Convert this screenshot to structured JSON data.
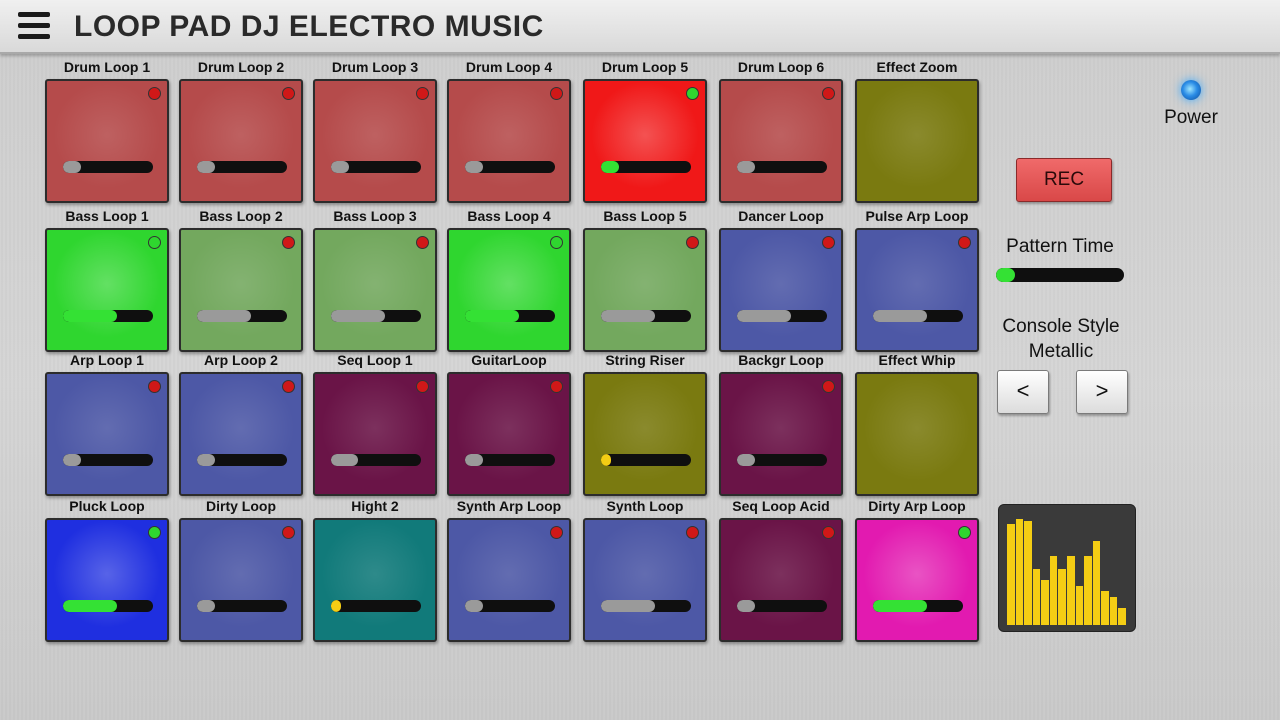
{
  "app": {
    "title": "LOOP PAD DJ ELECTRO MUSIC"
  },
  "pads": [
    {
      "label": "Drum Loop 1",
      "color": "#b54b4b",
      "active": false,
      "led": "red",
      "level": 0.2
    },
    {
      "label": "Drum Loop 2",
      "color": "#b54b4b",
      "active": false,
      "led": "red",
      "level": 0.2
    },
    {
      "label": "Drum Loop 3",
      "color": "#b54b4b",
      "active": false,
      "led": "red",
      "level": 0.2
    },
    {
      "label": "Drum Loop 4",
      "color": "#b54b4b",
      "active": false,
      "led": "red",
      "level": 0.2
    },
    {
      "label": "Drum Loop 5",
      "color": "#f01818",
      "active": true,
      "led": "green",
      "level": 0.2
    },
    {
      "label": "Drum Loop 6",
      "color": "#b54b4b",
      "active": false,
      "led": "red",
      "level": 0.2
    },
    {
      "label": "Effect Zoom",
      "color": "#7a7a10",
      "active": false,
      "led": "none",
      "level": null
    },
    {
      "label": "Bass Loop 1",
      "color": "#2fd62f",
      "active": true,
      "led": "green",
      "level": 0.6
    },
    {
      "label": "Bass Loop 2",
      "color": "#73a85e",
      "active": false,
      "led": "red",
      "level": 0.6
    },
    {
      "label": "Bass Loop 3",
      "color": "#73a85e",
      "active": false,
      "led": "red",
      "level": 0.6
    },
    {
      "label": "Bass Loop 4",
      "color": "#2fd62f",
      "active": true,
      "led": "green",
      "level": 0.6
    },
    {
      "label": "Bass Loop 5",
      "color": "#73a85e",
      "active": false,
      "led": "red",
      "level": 0.6
    },
    {
      "label": "Dancer Loop",
      "color": "#4d58a6",
      "active": false,
      "led": "red",
      "level": 0.6
    },
    {
      "label": "Pulse Arp Loop",
      "color": "#4d58a6",
      "active": false,
      "led": "red",
      "level": 0.6
    },
    {
      "label": "Arp Loop 1",
      "color": "#4d58a6",
      "active": false,
      "led": "red",
      "level": 0.2
    },
    {
      "label": "Arp Loop 2",
      "color": "#4d58a6",
      "active": false,
      "led": "red",
      "level": 0.2
    },
    {
      "label": "Seq Loop 1",
      "color": "#6a1447",
      "active": false,
      "led": "red",
      "level": 0.3
    },
    {
      "label": "GuitarLoop",
      "color": "#6a1447",
      "active": false,
      "led": "red",
      "level": 0.2
    },
    {
      "label": "String Riser",
      "color": "#7a7a10",
      "active": false,
      "led": "none",
      "level": 0.05
    },
    {
      "label": "Backgr Loop",
      "color": "#6a1447",
      "active": false,
      "led": "red",
      "level": 0.2
    },
    {
      "label": "Effect Whip",
      "color": "#7a7a10",
      "active": false,
      "led": "none",
      "level": null
    },
    {
      "label": "Pluck Loop",
      "color": "#1f2fe0",
      "active": true,
      "led": "green",
      "level": 0.6
    },
    {
      "label": "Dirty Loop",
      "color": "#4d58a6",
      "active": false,
      "led": "red",
      "level": 0.2
    },
    {
      "label": "Hight 2",
      "color": "#117a7a",
      "active": false,
      "led": "none",
      "level": 0.05
    },
    {
      "label": "Synth Arp Loop",
      "color": "#4d58a6",
      "active": false,
      "led": "red",
      "level": 0.2
    },
    {
      "label": "Synth Loop",
      "color": "#4d58a6",
      "active": false,
      "led": "red",
      "level": 0.6
    },
    {
      "label": "Seq Loop Acid",
      "color": "#6a1447",
      "active": false,
      "led": "red",
      "level": 0.2
    },
    {
      "label": "Dirty Arp Loop",
      "color": "#e21ab0",
      "active": true,
      "led": "green",
      "level": 0.6
    }
  ],
  "controls": {
    "power_label": "Power",
    "rec_label": "REC",
    "pattern_time_label": "Pattern Time",
    "pattern_time_level": 0.15,
    "console_style_label": "Console Style",
    "console_style_value": "Metallic",
    "prev_label": "<",
    "next_label": ">"
  },
  "visualizer": {
    "bar_levels": [
      0.9,
      0.95,
      0.93,
      0.5,
      0.4,
      0.62,
      0.5,
      0.62,
      0.35,
      0.62,
      0.75,
      0.3,
      0.25,
      0.15
    ]
  },
  "colors": {
    "led_red": "#d01818",
    "led_green": "#2fd62f",
    "bar_gray": "#9a9a9a",
    "bar_green": "#34e134",
    "bar_yellow": "#f4cd14",
    "visualizer_bar": "#f4cd14"
  }
}
